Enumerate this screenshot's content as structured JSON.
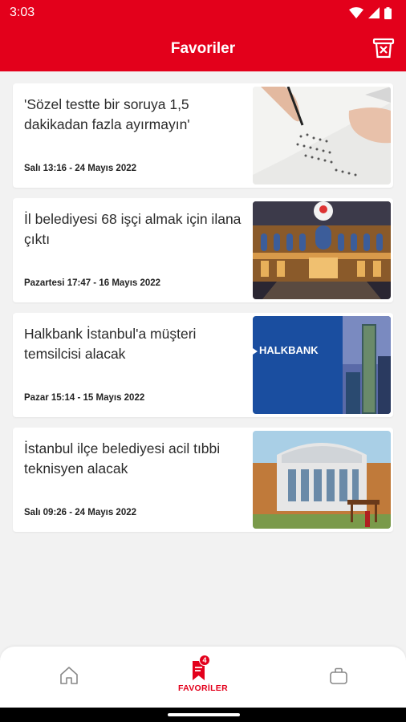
{
  "status": {
    "time": "3:03"
  },
  "header": {
    "title": "Favoriler"
  },
  "favorites": [
    {
      "title": "'Sözel testte bir soruya 1,5 dakikadan fazla ayırmayın'",
      "date": "Salı 13:16 - 24 Mayıs 2022",
      "image": "exam-paper"
    },
    {
      "title": "İl belediyesi 68 işçi almak için ilana çıktı",
      "date": "Pazartesi 17:47 - 16 Mayıs 2022",
      "image": "municipality-building"
    },
    {
      "title": "Halkbank İstanbul'a müşteri temsilcisi alacak",
      "date": "Pazar 15:14 - 15 Mayıs 2022",
      "image": "halkbank",
      "logo_text": "HALKBANK"
    },
    {
      "title": "İstanbul ilçe belediyesi acil tıbbi teknisyen alacak",
      "date": "Salı 09:26 - 24 Mayıs 2022",
      "image": "district-building"
    }
  ],
  "bottom_nav": {
    "fav_label": "FAVORİLER",
    "fav_count": "4"
  },
  "colors": {
    "primary": "#e3001b",
    "halkbank_blue": "#1a4ea0"
  }
}
